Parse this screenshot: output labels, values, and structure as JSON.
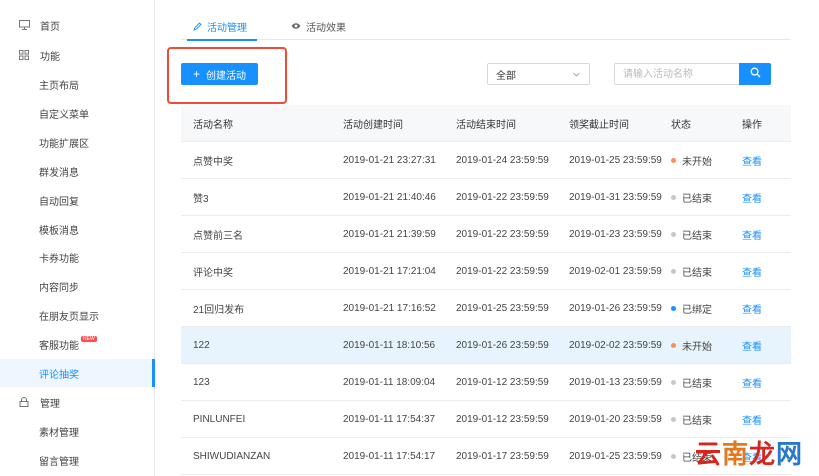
{
  "sidebar": {
    "home": "首页",
    "functions": "功能",
    "items": [
      {
        "label": "主页布局"
      },
      {
        "label": "自定义菜单"
      },
      {
        "label": "功能扩展区"
      },
      {
        "label": "群发消息"
      },
      {
        "label": "自动回复"
      },
      {
        "label": "模板消息"
      },
      {
        "label": "卡券功能"
      },
      {
        "label": "内容同步"
      },
      {
        "label": "在朋友页显示"
      },
      {
        "label": "客服功能",
        "badge": "NEW"
      },
      {
        "label": "评论抽奖",
        "active": true
      }
    ],
    "manage": "管理",
    "manage_items": [
      {
        "label": "素材管理"
      },
      {
        "label": "留言管理"
      }
    ]
  },
  "tabs": [
    {
      "label": "活动管理",
      "active": true,
      "icon": "edit-icon"
    },
    {
      "label": "活动效果",
      "active": false,
      "icon": "eye-icon"
    }
  ],
  "toolbar": {
    "create_label": "创建活动",
    "filter_value": "全部",
    "search_placeholder": "请输入活动名称"
  },
  "table": {
    "headers": {
      "name": "活动名称",
      "created": "活动创建时间",
      "end": "活动结束时间",
      "claim": "领奖截止时间",
      "status": "状态",
      "op": "操作"
    },
    "rows": [
      {
        "name": "点赞中奖",
        "created": "2019-01-21 23:27:31",
        "end": "2019-01-24 23:59:59",
        "claim": "2019-01-25 23:59:59",
        "status": "未开始",
        "status_color": "#ff8c55",
        "op": "查看"
      },
      {
        "name": "赞3",
        "created": "2019-01-21 21:40:46",
        "end": "2019-01-22 23:59:59",
        "claim": "2019-01-31 23:59:59",
        "status": "已结束",
        "status_color": "#c8c8c8",
        "op": "查看"
      },
      {
        "name": "点赞前三名",
        "created": "2019-01-21 21:39:59",
        "end": "2019-01-22 23:59:59",
        "claim": "2019-01-23 23:59:59",
        "status": "已结束",
        "status_color": "#c8c8c8",
        "op": "查看"
      },
      {
        "name": "评论中奖",
        "created": "2019-01-21 17:21:04",
        "end": "2019-01-22 23:59:59",
        "claim": "2019-02-01 23:59:59",
        "status": "已结束",
        "status_color": "#c8c8c8",
        "op": "查看"
      },
      {
        "name": "21回归发布",
        "created": "2019-01-21 17:16:52",
        "end": "2019-01-25 23:59:59",
        "claim": "2019-01-26 23:59:59",
        "status": "已绑定",
        "status_color": "#1890ff",
        "op": "查看"
      },
      {
        "name": "122",
        "created": "2019-01-11 18:10:56",
        "end": "2019-01-26 23:59:59",
        "claim": "2019-02-02 23:59:59",
        "status": "未开始",
        "status_color": "#ff8c55",
        "op": "查看",
        "highlight": true
      },
      {
        "name": "123",
        "created": "2019-01-11 18:09:04",
        "end": "2019-01-12 23:59:59",
        "claim": "2019-01-13 23:59:59",
        "status": "已结束",
        "status_color": "#c8c8c8",
        "op": "查看"
      },
      {
        "name": "PINLUNFEI",
        "created": "2019-01-11 17:54:37",
        "end": "2019-01-12 23:59:59",
        "claim": "2019-01-20 23:59:59",
        "status": "已结束",
        "status_color": "#c8c8c8",
        "op": "查看"
      },
      {
        "name": "SHIWUDIANZAN",
        "created": "2019-01-11 17:54:17",
        "end": "2019-01-17 23:59:59",
        "claim": "2019-01-25 23:59:59",
        "status": "已结束",
        "status_color": "#c8c8c8",
        "op": "查看"
      }
    ]
  },
  "watermark": {
    "chars": [
      "云",
      "南",
      "龙",
      "网"
    ]
  },
  "colors": {
    "accent": "#1890ff",
    "highlight_box": "#ef4c35"
  }
}
